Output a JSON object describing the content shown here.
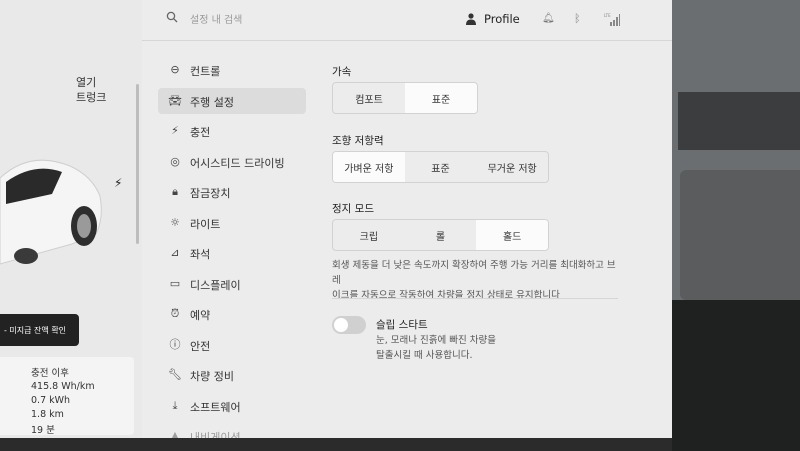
{
  "left_panel": {
    "open_label_1": "열기",
    "open_label_2": "트렁크",
    "promo_text": "- 미지급 잔액 확인",
    "trip": {
      "title": "충전 이후",
      "energy_per_km": "415.8 Wh/km",
      "energy": "0.7 kWh",
      "distance": "1.8 km",
      "partial": "19 분"
    }
  },
  "header": {
    "search_placeholder": "설정 내 검색",
    "profile_label": "Profile"
  },
  "sidebar": {
    "items": [
      {
        "label": "컨트롤",
        "icon": "toggle-icon"
      },
      {
        "label": "주행 설정",
        "icon": "car-icon"
      },
      {
        "label": "충전",
        "icon": "bolt-icon"
      },
      {
        "label": "어시스티드 드라이빙",
        "icon": "steering-wheel-icon"
      },
      {
        "label": "잠금장치",
        "icon": "lock-icon"
      },
      {
        "label": "라이트",
        "icon": "light-icon"
      },
      {
        "label": "좌석",
        "icon": "seat-icon"
      },
      {
        "label": "디스플레이",
        "icon": "display-icon"
      },
      {
        "label": "예약",
        "icon": "clock-icon"
      },
      {
        "label": "안전",
        "icon": "info-icon"
      },
      {
        "label": "차량 정비",
        "icon": "wrench-icon"
      },
      {
        "label": "소프트웨어",
        "icon": "download-icon"
      },
      {
        "label": "내비게이션",
        "icon": "navigation-icon"
      }
    ],
    "active_index": 1
  },
  "content": {
    "acceleration": {
      "title": "가속",
      "options": [
        "컴포트",
        "표준"
      ],
      "selected": "표준"
    },
    "steering": {
      "title": "조향 저항력",
      "options": [
        "가벼운 저항",
        "표준",
        "무거운 저항"
      ],
      "selected": "가벼운 저항"
    },
    "stop_mode": {
      "title": "정지 모드",
      "options": [
        "크립",
        "롤",
        "홀드"
      ],
      "selected": "홀드"
    },
    "stop_desc_line1": "회생 제동을 더 낮은 속도까지 확장하여 주행 가능 거리를 최대화하고 브레",
    "stop_desc_line2": "이크를 자동으로 작동하여 차량을 정지 상태로 유지합니다",
    "slip_start": {
      "title": "슬립 스타트",
      "desc_line1": "눈, 모래나 진흙에 빠진 차량을",
      "desc_line2": "탈출시킬 때 사용합니다.",
      "enabled": false
    }
  }
}
